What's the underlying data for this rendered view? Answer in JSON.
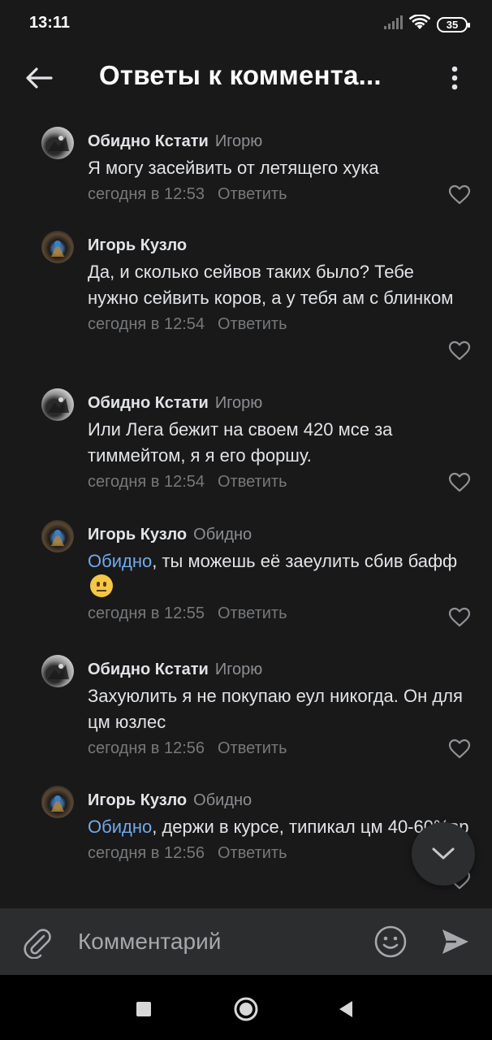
{
  "status_bar": {
    "time": "13:11",
    "battery": "35",
    "icons": [
      "signal-icon",
      "wifi-icon",
      "battery-icon"
    ]
  },
  "header": {
    "title": "Ответы к коммента..."
  },
  "comments": [
    {
      "author": "Обидно Кстати",
      "reply_to": "Игорю",
      "text": "Я могу засейвить от летящего хука",
      "time": "сегодня в 12:53",
      "reply_label": "Ответить"
    },
    {
      "author": "Игорь Кузло",
      "reply_to": "",
      "text": "Да, и сколько сейвов таких было? Тебе нужно сейвить коров, а у тебя ам с блинком",
      "time": "сегодня в 12:54",
      "reply_label": "Ответить"
    },
    {
      "author": "Обидно Кстати",
      "reply_to": "Игорю",
      "text": "Или Лега бежит на своем 420 мсе за тиммейтом, я я его форшу.",
      "time": "сегодня в 12:54",
      "reply_label": "Ответить"
    },
    {
      "author": "Игорь Кузло",
      "reply_to": "Обидно",
      "mention": "Обидно",
      "text": ", ты можешь её заеулить сбив бафф",
      "emoji": "neutral-face-emoji",
      "time": "сегодня в 12:55",
      "reply_label": "Ответить"
    },
    {
      "author": "Обидно Кстати",
      "reply_to": "Игорю",
      "text": "Захуюлить я не покупаю еул никогда. Он для цм юзлес",
      "time": "сегодня в 12:56",
      "reply_label": "Ответить"
    },
    {
      "author": "Игорь Кузло",
      "reply_to": "Обидно",
      "mention": "Обидно",
      "text": ", держи в курсе, типикал цм 40-60%вр",
      "time": "сегодня в 12:56",
      "reply_label": "Ответить"
    }
  ],
  "composer": {
    "placeholder": "Комментарий"
  },
  "colors": {
    "background": "#19191a",
    "mention": "#71aaeb",
    "secondary_text": "#76787a",
    "composer_bg": "#2c2d2e"
  }
}
